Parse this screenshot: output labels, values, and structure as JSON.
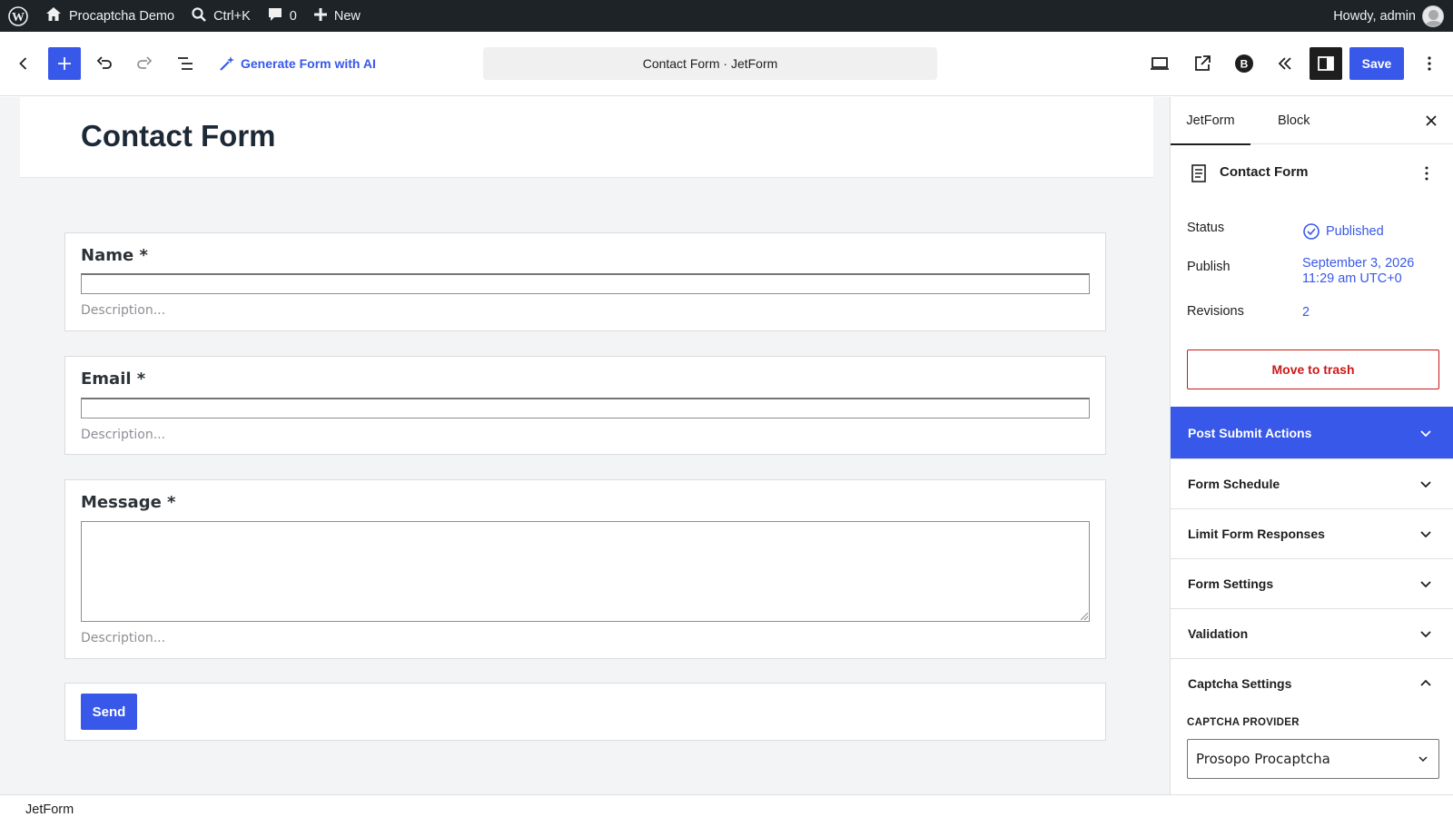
{
  "admin_bar": {
    "site_name": "Procaptcha Demo",
    "search_shortcut": "Ctrl+K",
    "comments_count": "0",
    "new_label": "New",
    "greeting": "Howdy, admin"
  },
  "header": {
    "generate_ai_label": "Generate Form with AI",
    "document_title": "Contact Form · JetForm",
    "save_label": "Save"
  },
  "canvas": {
    "title": "Contact Form",
    "fields": [
      {
        "label": "Name *",
        "description": "Description..."
      },
      {
        "label": "Email *",
        "description": "Description..."
      },
      {
        "label": "Message *",
        "description": "Description..."
      }
    ],
    "send_label": "Send"
  },
  "sidebar": {
    "tabs": [
      "JetForm",
      "Block"
    ],
    "post_title": "Contact Form",
    "status_label": "Status",
    "status_value": "Published",
    "publish_label": "Publish",
    "publish_date": "September 3, 2026",
    "publish_time": "11:29 am UTC+0",
    "revisions_label": "Revisions",
    "revisions_value": "2",
    "trash_label": "Move to trash",
    "panels": [
      "Post Submit Actions",
      "Form Schedule",
      "Limit Form Responses",
      "Form Settings",
      "Validation",
      "Captcha Settings"
    ],
    "captcha_provider_label": "CAPTCHA PROVIDER",
    "captcha_provider_value": "Prosopo Procaptcha"
  },
  "footer": {
    "breadcrumb": "JetForm"
  },
  "colors": {
    "accent": "#3858e9",
    "admin_bar": "#1d2327",
    "danger": "#cc1818"
  }
}
